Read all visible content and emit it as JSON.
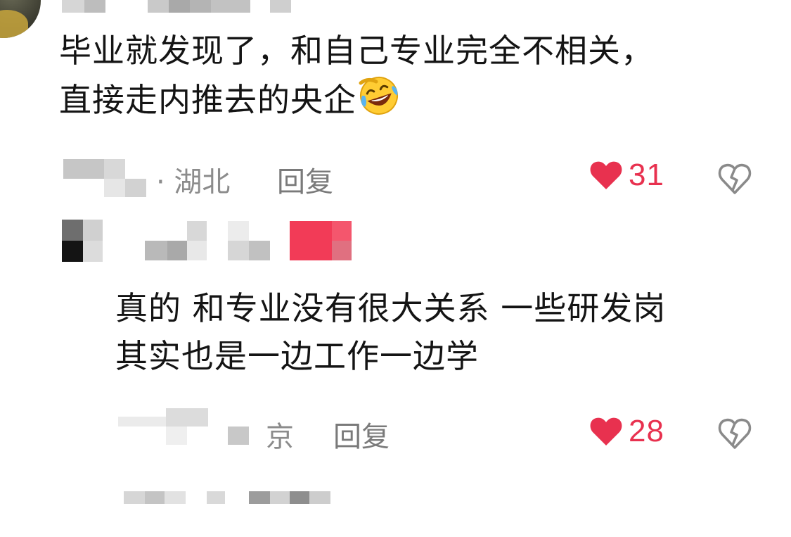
{
  "comments": [
    {
      "text_lines": [
        "毕业就发现了，和自己专业完全不相关，",
        "直接走内推去的央企"
      ],
      "emoji": "rofl-emoji",
      "meta_location": "· 湖北",
      "reply_label": "回复",
      "like_count": "31"
    },
    {
      "text_lines": [
        "真的 和专业没有很大关系 一些研发岗",
        "其实也是一边工作一边学"
      ],
      "meta_location": "京",
      "reply_label": "回复",
      "like_count": "28"
    }
  ],
  "icons": {
    "like": "heart-icon",
    "dislike": "broken-heart-icon"
  },
  "colors": {
    "like_red": "#e8314f",
    "meta_gray": "#8c8c8c",
    "text": "#141414"
  }
}
